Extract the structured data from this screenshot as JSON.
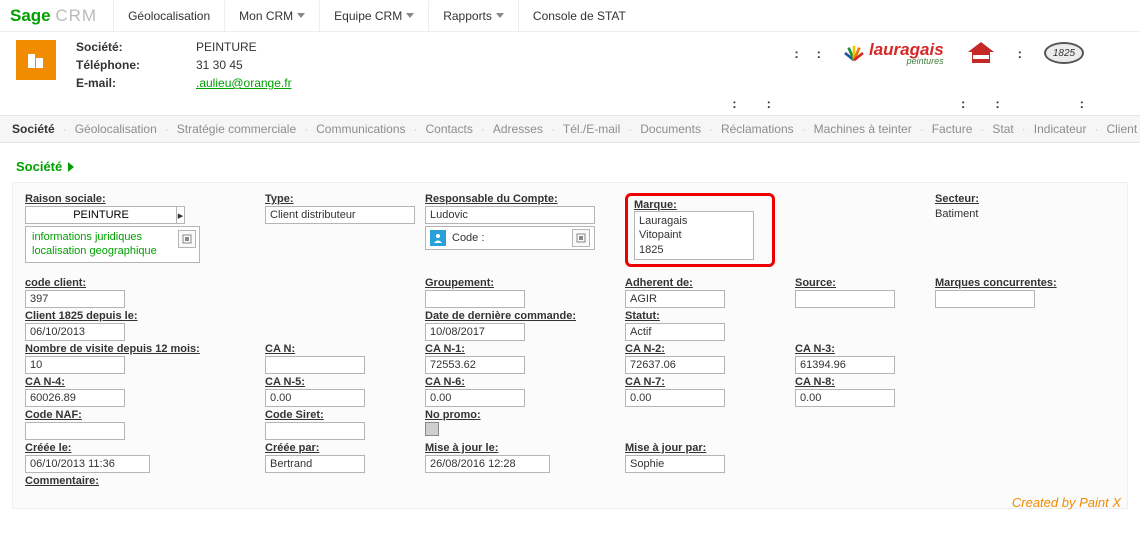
{
  "brand": {
    "sage": "Sage",
    "crm": "CRM"
  },
  "topmenu": [
    "Géolocalisation",
    "Mon CRM",
    "Equipe CRM",
    "Rapports",
    "Console de STAT"
  ],
  "header": {
    "societe_label": "Société:",
    "societe_value": "PEINTURE",
    "tel_label": "Téléphone:",
    "tel_value": "31 30 45",
    "email_label": "E-mail:",
    "email_value": ".aulieu@orange.fr"
  },
  "logos": {
    "lauragais": "lauragais",
    "lauragais_sub": "peintures",
    "oval": "1825"
  },
  "subnav": [
    "Société",
    "Géolocalisation",
    "Stratégie commerciale",
    "Communications",
    "Contacts",
    "Adresses",
    "Tél./E-mail",
    "Documents",
    "Réclamations",
    "Machines à teinter",
    "Facture",
    "Stat",
    "Indicateur",
    "Client du Distrib"
  ],
  "section_title": "Société",
  "fields": {
    "raison_sociale": {
      "label": "Raison sociale:",
      "value": "PEINTURE"
    },
    "info_juridiques": "informations juridiques",
    "loc_geo": "localisation geographique",
    "type": {
      "label": "Type:",
      "value": "Client distributeur"
    },
    "responsable": {
      "label": "Responsable du Compte:",
      "value": "Ludovic"
    },
    "code_label": "Code :",
    "marque": {
      "label": "Marque:",
      "values": [
        "Lauragais",
        "Vitopaint",
        "1825"
      ]
    },
    "secteur": {
      "label": "Secteur:",
      "value": "Batiment"
    },
    "code_client": {
      "label": "code client:",
      "value": "397"
    },
    "groupement": {
      "label": "Groupement:",
      "value": ""
    },
    "adherent": {
      "label": "Adherent de:",
      "value": "AGIR"
    },
    "source": {
      "label": "Source:",
      "value": ""
    },
    "marques_conc": {
      "label": "Marques concurrentes:",
      "value": ""
    },
    "client1825": {
      "label": "Client 1825 depuis le:",
      "value": "06/10/2013"
    },
    "date_derniere": {
      "label": "Date de dernière commande:",
      "value": "10/08/2017"
    },
    "statut": {
      "label": "Statut:",
      "value": "Actif"
    },
    "nb_visite": {
      "label": "Nombre de visite depuis 12 mois:",
      "value": "10"
    },
    "can": {
      "label": "CA N:",
      "value": ""
    },
    "can1": {
      "label": "CA N-1:",
      "value": "72553.62"
    },
    "can2": {
      "label": "CA N-2:",
      "value": "72637.06"
    },
    "can3": {
      "label": "CA N-3:",
      "value": "61394.96"
    },
    "can4": {
      "label": "CA N-4:",
      "value": "60026.89"
    },
    "can5": {
      "label": "CA N-5:",
      "value": "0.00"
    },
    "can6": {
      "label": "CA N-6:",
      "value": "0.00"
    },
    "can7": {
      "label": "CA N-7:",
      "value": "0.00"
    },
    "can8": {
      "label": "CA N-8:",
      "value": "0.00"
    },
    "code_naf": {
      "label": "Code NAF:",
      "value": ""
    },
    "code_siret": {
      "label": "Code Siret:",
      "value": ""
    },
    "no_promo": {
      "label": "No promo:"
    },
    "creee_le": {
      "label": "Créée le:",
      "value": "06/10/2013 11:36"
    },
    "creee_par": {
      "label": "Créée par:",
      "value": "Bertrand"
    },
    "maj_le": {
      "label": "Mise à jour le:",
      "value": "26/08/2016 12:28"
    },
    "maj_par": {
      "label": "Mise à jour par:",
      "value": "Sophie"
    },
    "commentaire": {
      "label": "Commentaire:"
    }
  },
  "footer_credit": "Created by Paint X"
}
